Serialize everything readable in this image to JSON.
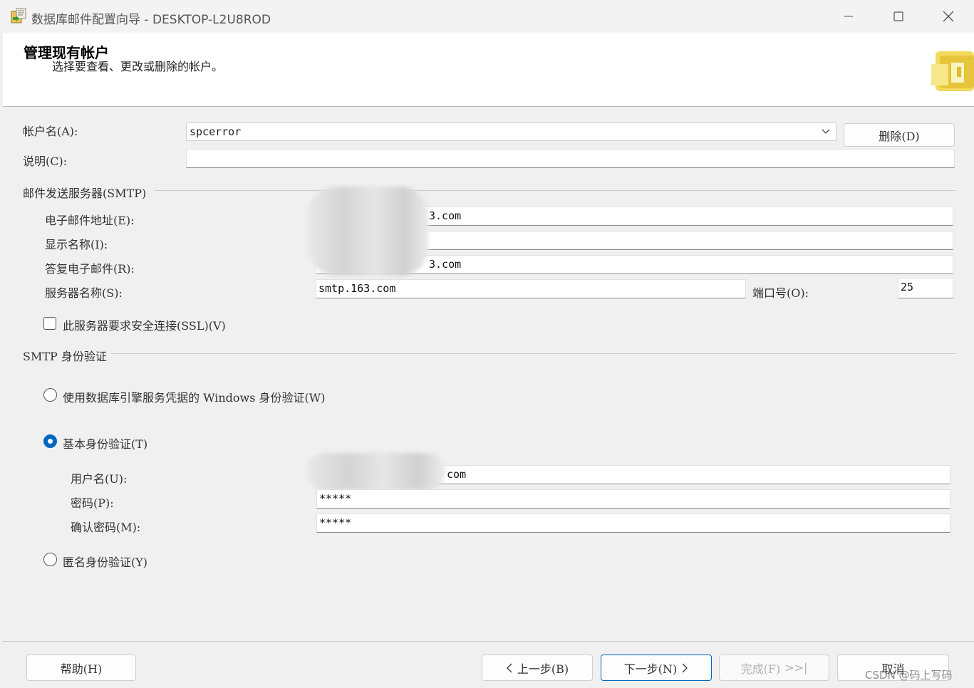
{
  "window": {
    "title": "数据库邮件配置向导 - DESKTOP-L2U8ROD",
    "minimize_icon": "minimize-icon",
    "maximize_icon": "maximize-icon",
    "close_icon": "close-icon"
  },
  "header": {
    "title": "管理现有帐户",
    "subtitle": "选择要查看、更改或删除的帐户。"
  },
  "account": {
    "name_label": "帐户名(A):",
    "name_value": "spcerror",
    "delete_label": "删除(D)",
    "description_label": "说明(C):",
    "description_value": ""
  },
  "smtp": {
    "group_label": "邮件发送服务器(SMTP)",
    "email_label": "电子邮件地址(E):",
    "email_value": "3.com",
    "display_name_label": "显示名称(I):",
    "display_name_value": "",
    "reply_label": "答复电子邮件(R):",
    "reply_value": "3.com",
    "server_label": "服务器名称(S):",
    "server_value": "smtp.163.com",
    "port_label": "端口号(O):",
    "port_value": "25",
    "ssl_label": "此服务器要求安全连接(SSL)(V)",
    "ssl_checked": false
  },
  "auth": {
    "group_label": "SMTP 身份验证",
    "windows_label": "使用数据库引擎服务凭据的 Windows 身份验证(W)",
    "basic_label": "基本身份验证(T)",
    "selected": "basic",
    "username_label": "用户名(U):",
    "username_value": "com",
    "password_label": "密码(P):",
    "password_value": "*****",
    "confirm_label": "确认密码(M):",
    "confirm_value": "*****",
    "anonymous_label": "匿名身份验证(Y)"
  },
  "footer": {
    "help_label": "帮助(H)",
    "back_label": "上一步(B)",
    "next_label": "下一步(N)",
    "finish_label": "完成(F)",
    "finish_suffix": ">>|",
    "cancel_label": "取消"
  },
  "watermark": "CSDN @码上写码",
  "colors": {
    "accent": "#0067c0",
    "background": "#f0f0f0"
  }
}
